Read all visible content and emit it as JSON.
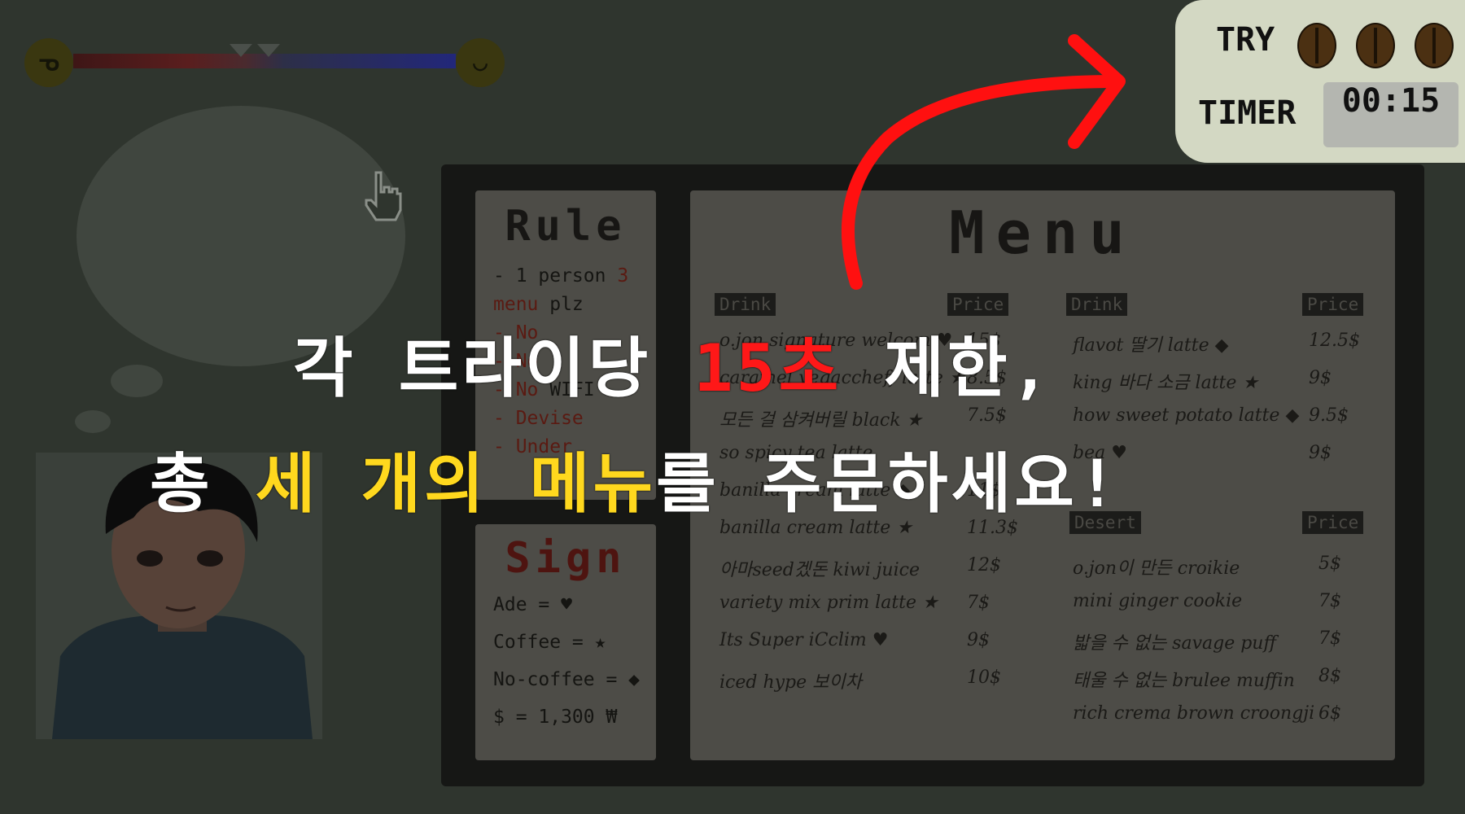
{
  "hud": {
    "try_label": "TRY",
    "tries_remaining": 3,
    "timer_label": "TIMER",
    "timer_value": "00:15"
  },
  "mood": {
    "sad_face": "sad-face-icon",
    "happy_face": "happy-face-icon"
  },
  "rule": {
    "title": "Rule",
    "line1a": "- 1 person ",
    "line1b": "3",
    "line1c": "menu",
    "line1d": " plz",
    "line2": "- No",
    "line3a": "- No ",
    "line3b": "WIFI",
    "line4": "- Devise",
    "line5": "- Under"
  },
  "sign": {
    "title": "Sign",
    "ade": "Ade  =  ♥",
    "coffee": "Coffee  = ★",
    "nocoffee": "No-coffee  = ◆",
    "currency": "$  = 1,300 ₩"
  },
  "menu": {
    "title": "Menu",
    "drink_header": "Drink",
    "price_header": "Price",
    "desert_header": "Desert",
    "left_items": [
      {
        "name": "o.jon signature welcom ♥",
        "price": "15$"
      },
      {
        "name": "caramel yegaccheff latte ★",
        "price": "8.5$"
      },
      {
        "name": "모든 걸 삼켜버릴 black ★",
        "price": "7.5$"
      },
      {
        "name": "so spicy  tea latte",
        "price": ""
      },
      {
        "name": "banilla cream latte ◆",
        "price": "11$"
      },
      {
        "name": "banilla cream latte ★",
        "price": "11.3$"
      },
      {
        "name": "아마seed겠돈 kiwi juice",
        "price": "12$"
      },
      {
        "name": "variety mix prim latte ★",
        "price": "7$"
      },
      {
        "name": "Its Super iCclim ♥",
        "price": "9$"
      },
      {
        "name": "iced hype 보이차",
        "price": "10$"
      }
    ],
    "right_drinks": [
      {
        "name": "flavot 딸기 latte ◆",
        "price": "12.5$"
      },
      {
        "name": "king 바다 소금 latte ★",
        "price": "9$"
      },
      {
        "name": "how sweet potato latte ◆",
        "price": "9.5$"
      },
      {
        "name": "bea   ♥",
        "price": "9$"
      }
    ],
    "deserts": [
      {
        "name": "o.jon이 만든 croikie",
        "price": "5$"
      },
      {
        "name": "mini ginger cookie",
        "price": "7$"
      },
      {
        "name": "밟을 수 없는 savage puff",
        "price": "7$"
      },
      {
        "name": "태울 수 없는 brulee muffin",
        "price": "8$"
      },
      {
        "name": "rich crema brown croongji",
        "price": "6$"
      }
    ]
  },
  "overlay": {
    "line1_a": "각 트라이당 ",
    "line1_b": "15초",
    "line1_c": " 제한,",
    "line2_a": "총 ",
    "line2_b": "세 개의 메뉴",
    "line2_c": "를 주문하세요!"
  },
  "colors": {
    "highlight_red": "#ff1818",
    "highlight_yellow": "#ffd81e",
    "arrow": "#ff1010"
  }
}
